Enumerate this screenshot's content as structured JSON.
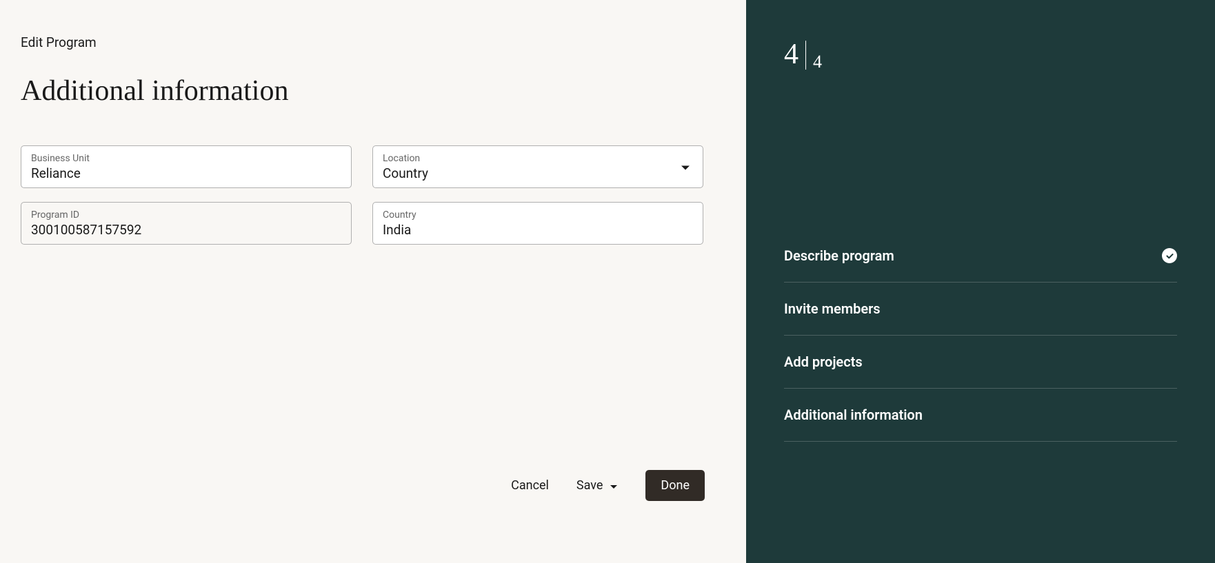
{
  "breadcrumb": "Edit Program",
  "page_title": "Additional information",
  "fields": {
    "business_unit": {
      "label": "Business Unit",
      "value": "Reliance"
    },
    "location": {
      "label": "Location",
      "value": "Country"
    },
    "program_id": {
      "label": "Program ID",
      "value": "300100587157592"
    },
    "country": {
      "label": "Country",
      "value": "India"
    }
  },
  "buttons": {
    "cancel": "Cancel",
    "save": "Save",
    "done": "Done"
  },
  "progress": {
    "current": "4",
    "total": "4"
  },
  "steps": [
    {
      "label": "Describe program",
      "completed": true,
      "active": false
    },
    {
      "label": "Invite members",
      "completed": false,
      "active": false
    },
    {
      "label": "Add projects",
      "completed": false,
      "active": false
    },
    {
      "label": "Additional information",
      "completed": false,
      "active": true
    }
  ]
}
